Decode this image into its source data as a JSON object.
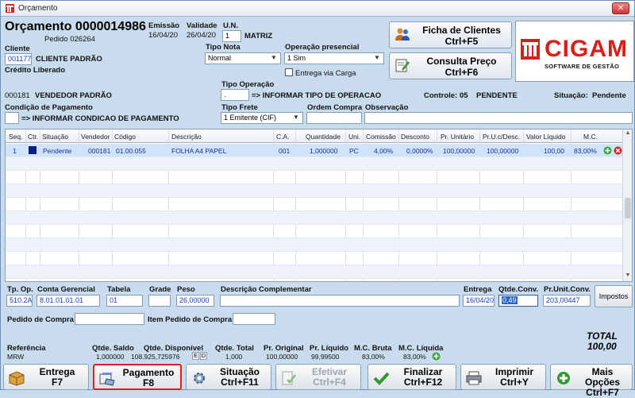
{
  "window": {
    "title": "Orçamento",
    "close": "✕"
  },
  "header": {
    "orcamento_title": "Orçamento 0000014986",
    "pedido": "Pedido 026264",
    "emissao_label": "Emissão",
    "emissao": "16/04/20",
    "validade_label": "Validade",
    "validade": "26/04/20",
    "un_label": "U.N.",
    "un_value": "1",
    "un_name": "MATRIZ",
    "cliente_label": "Cliente",
    "cliente_code": "001177",
    "cliente_name": "CLIENTE PADRÃO",
    "credito": "Crédito Liberado",
    "tipo_nota_label": "Tipo Nota",
    "tipo_nota": "Normal",
    "operacao_label": "Operação presencial",
    "operacao": "1 Sim",
    "entrega_via_carga": "Entrega via Carga",
    "vendedor_code": "000181",
    "vendedor_name": "VENDEDOR PADRÃO",
    "tipo_operacao_label": "Tipo Operação",
    "tipo_operacao_code": ".",
    "tipo_operacao_text": "=> INFORMAR TIPO DE OPERACAO",
    "controle_label": "Controle:",
    "controle_value": "05",
    "controle_status": "PENDENTE",
    "situacao_label": "Situação:",
    "situacao_value": "Pendente",
    "cond_pag_label": "Condição de Pagamento",
    "cond_pag_text": "=> INFORMAR CONDICAO DE PAGAMENTO",
    "tipo_frete_label": "Tipo Frete",
    "tipo_frete": "1 Emitente (CIF)",
    "ordem_compra_label": "Ordem Compra",
    "observacao_label": "Observação"
  },
  "top_buttons": {
    "ficha": {
      "line1": "Ficha de Clientes",
      "line2": "Ctrl+F5"
    },
    "consulta": {
      "line1": "Consulta Preço",
      "line2": "Ctrl+F6"
    }
  },
  "logo": {
    "brand": "CIGAM",
    "tagline": "SOFTWARE DE GESTÃO"
  },
  "grid": {
    "columns": [
      "Seq.",
      "Ctr.",
      "Situação",
      "Vendedor",
      "Código",
      "Descrição",
      "C.A.",
      "Quantidade",
      "Uni.",
      "Comissão",
      "Desconto",
      "Pr. Unitário",
      "Pr.U.c/Desc.",
      "Valor Líquido",
      "M.C."
    ],
    "rows": [
      {
        "seq": "1",
        "situacao": "Pendente",
        "vendedor": "000181",
        "codigo": "01.00.055",
        "descricao": "FOLHA A4 PAPEL",
        "ca": "001",
        "quantidade": "1,000000",
        "uni": "PC",
        "comissao": "4,00%",
        "desconto": "0,0000%",
        "pr_unit": "100,00000",
        "pr_desc": "100,00000",
        "valor": "100,00",
        "mc": "83,00%"
      }
    ]
  },
  "lower": {
    "tp_op_label": "Tp. Op.",
    "tp_op": "510.2A",
    "conta_label": "Conta Gerencial",
    "conta": "8.01.01.01.01",
    "tabela_label": "Tabela",
    "tabela": "01",
    "grade_label": "Grade",
    "peso_label": "Peso",
    "peso": "26,00000",
    "desc_comp_label": "Descrição Complementar",
    "entrega_label": "Entrega",
    "entrega": "16/04/20",
    "qtde_conv_label": "Qtde.Conv.",
    "qtde_conv": "0,49",
    "pr_unit_conv_label": "Pr.Unit.Conv.",
    "pr_unit_conv": "203,00447",
    "impostos": "Impostos",
    "pedido_compra_label": "Pedido de Compra",
    "item_pedido_label": "Item Pedido de Compra"
  },
  "totals": {
    "total_label": "TOTAL",
    "total_value": "100,00",
    "referencia_label": "Referência",
    "referencia": "MRW",
    "qtde_saldo_label": "Qtde. Saldo",
    "qtde_saldo": "1,000000",
    "qtde_disp_label": "Qtde. Disponível",
    "qtde_disp": "108.925,725976",
    "e_label": "E",
    "d_label": "D",
    "qtde_total_label": "Qtde. Total",
    "qtde_total": "1,000",
    "pr_original_label": "Pr. Original",
    "pr_original": "100,00000",
    "pr_liquido_label": "Pr. Líquido",
    "pr_liquido": "99,99500",
    "mc_bruta_label": "M.C. Bruta",
    "mc_bruta": "83,00%",
    "mc_liquida_label": "M.C. Líquida",
    "mc_liquida": "83,00%"
  },
  "bottom_buttons": {
    "entrega": {
      "line1": "Entrega",
      "line2": "F7"
    },
    "pagamento": {
      "line1": "Pagamento",
      "line2": "F8"
    },
    "situacao": {
      "line1": "Situação",
      "line2": "Ctrl+F11"
    },
    "efetivar": {
      "line1": "Efetivar",
      "line2": "Ctrl+F4"
    },
    "finalizar": {
      "line1": "Finalizar",
      "line2": "Ctrl+F12"
    },
    "imprimir": {
      "line1": "Imprimir",
      "line2": "Ctrl+Y"
    },
    "mais": {
      "line1": "Mais Opções",
      "line2": "Ctrl+F7"
    }
  }
}
